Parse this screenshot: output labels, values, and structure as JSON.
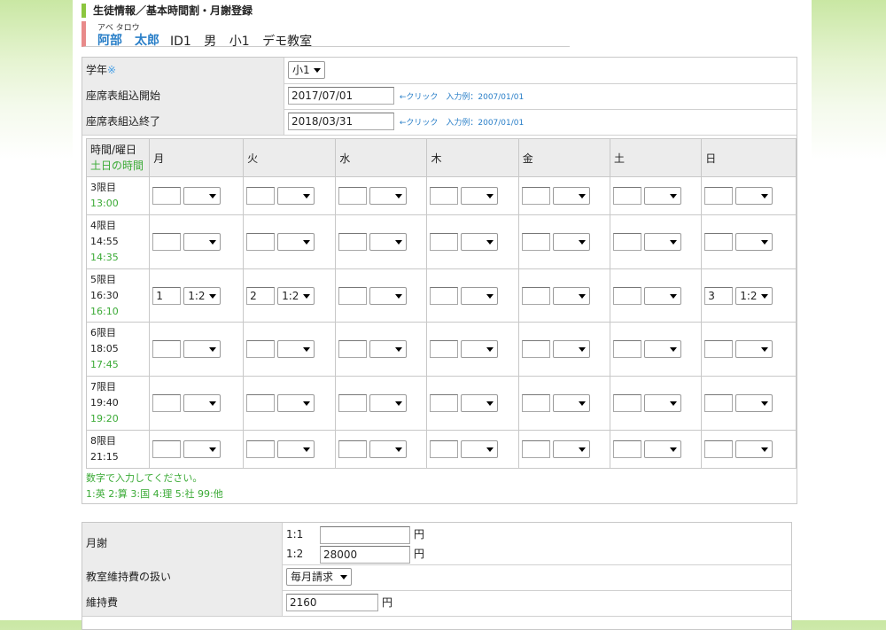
{
  "header": {
    "title": "生徒情報／基本時間割・月謝登録",
    "kana": "アベ タロウ",
    "name": "阿部　太郎",
    "id": "ID1",
    "gender": "男",
    "grade": "小1",
    "classroom": "デモ教室"
  },
  "basic": {
    "grade_label": "学年",
    "required_mark": "※",
    "grade_value": "小1",
    "start_label": "座席表組込開始",
    "start_value": "2017/07/01",
    "end_label": "座席表組込終了",
    "end_value": "2018/03/31",
    "click_hint": "←クリック　入力例：2007/01/01"
  },
  "timetable": {
    "corner_line1": "時間/曜日",
    "corner_line2": "土日の時間",
    "days": [
      "月",
      "火",
      "水",
      "木",
      "金",
      "土",
      "日"
    ],
    "periods": [
      {
        "label": "3限目",
        "time": "",
        "weekend": "13:00",
        "cells": [
          [
            "",
            ""
          ],
          [
            "",
            ""
          ],
          [
            "",
            ""
          ],
          [
            "",
            ""
          ],
          [
            "",
            ""
          ],
          [
            "",
            ""
          ],
          [
            "",
            ""
          ]
        ]
      },
      {
        "label": "4限目",
        "time": "14:55",
        "weekend": "14:35",
        "cells": [
          [
            "",
            ""
          ],
          [
            "",
            ""
          ],
          [
            "",
            ""
          ],
          [
            "",
            ""
          ],
          [
            "",
            ""
          ],
          [
            "",
            ""
          ],
          [
            "",
            ""
          ]
        ]
      },
      {
        "label": "5限目",
        "time": "16:30",
        "weekend": "16:10",
        "cells": [
          [
            "1",
            "1:2"
          ],
          [
            "2",
            "1:2"
          ],
          [
            "",
            ""
          ],
          [
            "",
            ""
          ],
          [
            "",
            ""
          ],
          [
            "",
            ""
          ],
          [
            "3",
            "1:2"
          ]
        ]
      },
      {
        "label": "6限目",
        "time": "18:05",
        "weekend": "17:45",
        "cells": [
          [
            "",
            ""
          ],
          [
            "",
            ""
          ],
          [
            "",
            ""
          ],
          [
            "",
            ""
          ],
          [
            "",
            ""
          ],
          [
            "",
            ""
          ],
          [
            "",
            ""
          ]
        ]
      },
      {
        "label": "7限目",
        "time": "19:40",
        "weekend": "19:20",
        "cells": [
          [
            "",
            ""
          ],
          [
            "",
            ""
          ],
          [
            "",
            ""
          ],
          [
            "",
            ""
          ],
          [
            "",
            ""
          ],
          [
            "",
            ""
          ],
          [
            "",
            ""
          ]
        ]
      },
      {
        "label": "8限目",
        "time": "21:15",
        "weekend": "",
        "cells": [
          [
            "",
            ""
          ],
          [
            "",
            ""
          ],
          [
            "",
            ""
          ],
          [
            "",
            ""
          ],
          [
            "",
            ""
          ],
          [
            "",
            ""
          ],
          [
            "",
            ""
          ]
        ]
      }
    ],
    "note1": "数字で入力してください。",
    "note2": "1:英  2:算  3:国  4:理  5:社  99:他"
  },
  "fees": {
    "monthly_label": "月謝",
    "one_to_one_label": "1:1",
    "one_to_one_value": "",
    "one_to_two_label": "1:2",
    "one_to_two_value": "28000",
    "yen": "円",
    "maintenance_handling_label": "教室維持費の扱い",
    "maintenance_handling_value": "毎月請求",
    "maintenance_label": "維持費",
    "maintenance_value": "2160"
  }
}
